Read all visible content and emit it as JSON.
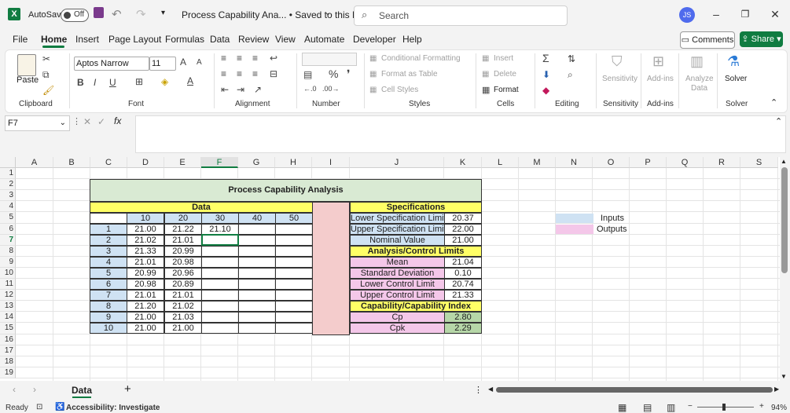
{
  "titlebar": {
    "app_letter": "X",
    "autosave_label": "AutoSave",
    "autosave_state": "Off",
    "doc_title": "Process Capability Ana... • Saved to this PC",
    "search_placeholder": "Search",
    "user_initials": "JS"
  },
  "menu": {
    "items": [
      "File",
      "Home",
      "Insert",
      "Page Layout",
      "Formulas",
      "Data",
      "Review",
      "View",
      "Automate",
      "Developer",
      "Help"
    ],
    "active": "Home",
    "comments": "Comments",
    "share": "Share"
  },
  "ribbon": {
    "paste": "Paste",
    "font_name": "Aptos Narrow",
    "font_size": "11",
    "bold": "B",
    "italic": "I",
    "underline": "U",
    "conditional_formatting": "Conditional Formatting",
    "format_as_table": "Format as Table",
    "cell_styles": "Cell Styles",
    "insert": "Insert",
    "delete": "Delete",
    "format": "Format",
    "sensitivity": "Sensitivity",
    "addins": "Add-ins",
    "analyze_data_1": "Analyze",
    "analyze_data_2": "Data",
    "solver": "Solver",
    "groups": {
      "clipboard": "Clipboard",
      "font": "Font",
      "alignment": "Alignment",
      "number": "Number",
      "styles": "Styles",
      "cells": "Cells",
      "editing": "Editing",
      "sensitivity": "Sensitivity",
      "addins": "Add-ins",
      "solver": "Solver"
    }
  },
  "formula_bar": {
    "name_box": "F7",
    "fx": "fx"
  },
  "grid": {
    "columns": [
      "A",
      "B",
      "C",
      "D",
      "E",
      "F",
      "G",
      "H",
      "I",
      "J",
      "K",
      "L",
      "M",
      "N",
      "O",
      "P",
      "Q",
      "R",
      "S"
    ],
    "rows": [
      "1",
      "2",
      "3",
      "4",
      "5",
      "6",
      "7",
      "8",
      "9",
      "10",
      "11",
      "12",
      "13",
      "14",
      "15",
      "16",
      "17",
      "18",
      "19"
    ],
    "selected_col": "F",
    "selected_row": "7"
  },
  "sheet": {
    "title": "Process Capability Analysis",
    "data_header": "Data",
    "data_cols": [
      "10",
      "20",
      "30",
      "40",
      "50"
    ],
    "sample_ids": [
      "1",
      "2",
      "3",
      "4",
      "5",
      "6",
      "7",
      "8",
      "9",
      "10"
    ],
    "col10": [
      "21.00",
      "21.02",
      "21.33",
      "21.01",
      "20.99",
      "20.98",
      "21.01",
      "21.20",
      "21.00",
      "21.00"
    ],
    "col20": [
      "21.22",
      "21.01",
      "20.99",
      "20.98",
      "20.96",
      "20.89",
      "21.01",
      "21.02",
      "21.03",
      "21.00"
    ],
    "col30": [
      "21.10"
    ],
    "specs_header": "Specifications",
    "lsl_label": "Lower Specification Limit",
    "lsl": "20.37",
    "usl_label": "Upper Specification Limit",
    "usl": "22.00",
    "nominal_label": "Nominal Value",
    "nominal": "21.00",
    "acl_header": "Analysis/Control Limits",
    "mean_label": "Mean",
    "mean": "21.04",
    "sd_label": "Standard Deviation",
    "sd": "0.10",
    "lcl_label": "Lower Control Limit",
    "lcl": "20.74",
    "ucl_label": "Upper Control Limit",
    "ucl": "21.33",
    "cap_header": "Capability/Capability Index",
    "cp_label": "Cp",
    "cp": "2.80",
    "cpk_label": "Cpk",
    "cpk": "2.29",
    "legend_inputs": "Inputs",
    "legend_outputs": "Outputs"
  },
  "tabs": {
    "sheet_name": "Data",
    "add": "+"
  },
  "status": {
    "ready": "Ready",
    "accessibility": "Accessibility: Investigate",
    "zoom": "94%"
  }
}
